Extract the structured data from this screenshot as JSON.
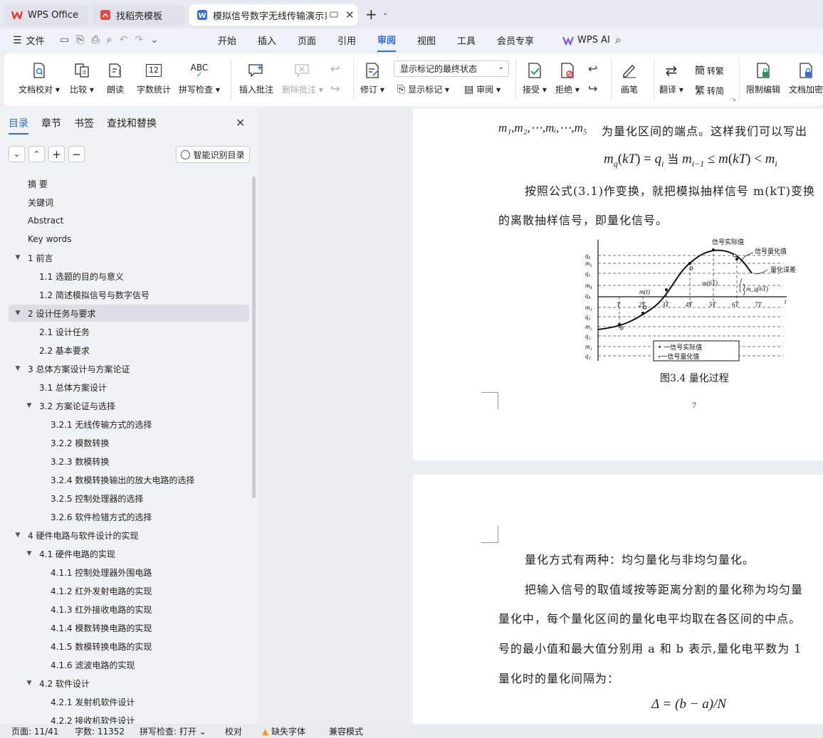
{
  "tabs": [
    {
      "label": "WPS Office",
      "icon": "wps-logo-icon"
    },
    {
      "label": "找稻壳模板",
      "icon": "docer-icon"
    },
    {
      "label": "模拟信号数字无线传输演示系统",
      "icon": "word-doc-icon"
    }
  ],
  "menu": {
    "file": "文件",
    "items": [
      "开始",
      "插入",
      "页面",
      "引用",
      "审阅",
      "视图",
      "工具",
      "会员专享"
    ],
    "active": "审阅",
    "ai": "WPS AI"
  },
  "ribbon": {
    "proofread": "文档校对",
    "compare": "比较",
    "read_aloud": "朗读",
    "word_count": "字数统计",
    "spell_check": "拼写检查",
    "insert_comment": "插入批注",
    "delete_comment": "删除批注",
    "revise": "修订",
    "display_state": "显示标记的最终状态",
    "show_markup": "显示标记",
    "review": "审阅",
    "accept": "接受",
    "reject": "拒绝",
    "pen": "画笔",
    "translate": "翻译",
    "to_traditional": "转繁",
    "to_simplified": "转简",
    "restrict_edit": "限制编辑",
    "doc_encrypt": "文档加密",
    "abc": "ABC",
    "count_num": "12"
  },
  "nav": {
    "tabs": [
      "目录",
      "章节",
      "书签",
      "查找和替换"
    ],
    "smart_btn": "智能识别目录",
    "items": [
      {
        "label": "摘  要",
        "level": 1,
        "arrow": ""
      },
      {
        "label": "关键词",
        "level": 1,
        "arrow": ""
      },
      {
        "label": "Abstract",
        "level": 1,
        "arrow": ""
      },
      {
        "label": "Key words",
        "level": 1,
        "arrow": ""
      },
      {
        "label": "1  前言",
        "level": 1,
        "arrow": "▼"
      },
      {
        "label": "1.1  选题的目的与意义",
        "level": 2,
        "arrow": ""
      },
      {
        "label": "1.2 简述模拟信号与数字信号",
        "level": 2,
        "arrow": ""
      },
      {
        "label": "2  设计任务与要求",
        "level": 1,
        "arrow": "▼"
      },
      {
        "label": "2.1  设计任务",
        "level": 2,
        "arrow": ""
      },
      {
        "label": "2.2    基本要求",
        "level": 2,
        "arrow": ""
      },
      {
        "label": "3  总体方案设计与方案论证",
        "level": 1,
        "arrow": "▼"
      },
      {
        "label": "3.1 总体方案设计",
        "level": 2,
        "arrow": ""
      },
      {
        "label": "3.2  方案论证与选择",
        "level": 2,
        "arrow": "▼"
      },
      {
        "label": "3.2.1  无线传输方式的选择",
        "level": 3,
        "arrow": ""
      },
      {
        "label": "3.2.2  模数转换",
        "level": 3,
        "arrow": ""
      },
      {
        "label": "3.2.3  数模转换",
        "level": 3,
        "arrow": ""
      },
      {
        "label": "3.2.4  数模转换输出的放大电路的选择",
        "level": 3,
        "arrow": ""
      },
      {
        "label": "3.2.5  控制处理器的选择",
        "level": 3,
        "arrow": ""
      },
      {
        "label": "3.2.6  软件检错方式的选择",
        "level": 3,
        "arrow": ""
      },
      {
        "label": "4  硬件电路与软件设计的实现",
        "level": 1,
        "arrow": "▼"
      },
      {
        "label": "4.1  硬件电路的实现",
        "level": 2,
        "arrow": "▼"
      },
      {
        "label": "4.1.1  控制处理器外围电路",
        "level": 3,
        "arrow": ""
      },
      {
        "label": "4.1.2  红外发射电路的实现",
        "level": 3,
        "arrow": ""
      },
      {
        "label": "4.1.3  红外接收电路的实现",
        "level": 3,
        "arrow": ""
      },
      {
        "label": "4.1.4  模数转换电路的实现",
        "level": 3,
        "arrow": ""
      },
      {
        "label": "4.1.5 数模转换电路的实现",
        "level": 3,
        "arrow": ""
      },
      {
        "label": "4.1.6 滤波电路的实现",
        "level": 3,
        "arrow": ""
      },
      {
        "label": "4.2  软件设计",
        "level": 2,
        "arrow": "▼"
      },
      {
        "label": "4.2.1  发射机软件设计",
        "level": 3,
        "arrow": ""
      },
      {
        "label": "4.2.2  接收机软件设计",
        "level": 3,
        "arrow": ""
      }
    ],
    "selected_index": 7
  },
  "doc": {
    "p1_line1": "为量化区间的端点。这样我们可以写出",
    "p1_line1_math": "m₁,m₂,⋯,mᵢ,⋯,m₅",
    "formula1": "m_q(kT) = q_i  当 m_{i−1} ≤ m(kT) < m_i",
    "p1_line2": "按照公式(3.1)作变换，就把模拟抽样信号 m(kT)变换",
    "p1_line3": "的离散抽样信号，即量化信号。",
    "figure_caption": "图3.4  量化过程",
    "fig": {
      "q_labels": [
        "q₆",
        "m₅",
        "q₅",
        "m₄",
        "q₄",
        "m₃",
        "q₃",
        "m₂",
        "q₂",
        "m₁",
        "q₁"
      ],
      "t_labels": [
        "T",
        "2T",
        "3T",
        "4T",
        "5T",
        "6T",
        "7T"
      ],
      "t_axis": "t",
      "ann_actual": "信号实际值",
      "ann_quant": "信号量化值",
      "ann_error": "量化误差",
      "ann_m6t": "m(6T)",
      "ann_mq6t": "m_q(6T)",
      "ann_mt": "m(t)",
      "legend_actual": "• 一信号实际值",
      "legend_quant": "∘一信号量化值"
    },
    "page_number": "7",
    "p2_line1": "量化方式有两种：均匀量化与非均匀量化。",
    "p2_line2": "把输入信号的取值域按等距离分割的量化称为均匀量",
    "p2_line3": "量化中，每个量化区间的量化电平均取在各区间的中点。",
    "p2_line4": "号的最小值和最大值分别用 a 和 b 表示,量化电平数为 1",
    "p2_line5": "量化时的量化间隔为：",
    "formula2": "Δ = (b − a)/N"
  },
  "status": {
    "page": "页面: 11/41",
    "words": "字数: 11352",
    "spell": "拼写检查: 打开",
    "proof": "校对",
    "missing_font": "缺失字体",
    "compat": "兼容模式"
  },
  "colors": {
    "accent": "#2f6de0",
    "wps_red": "#e33",
    "warning": "#f0a020"
  }
}
